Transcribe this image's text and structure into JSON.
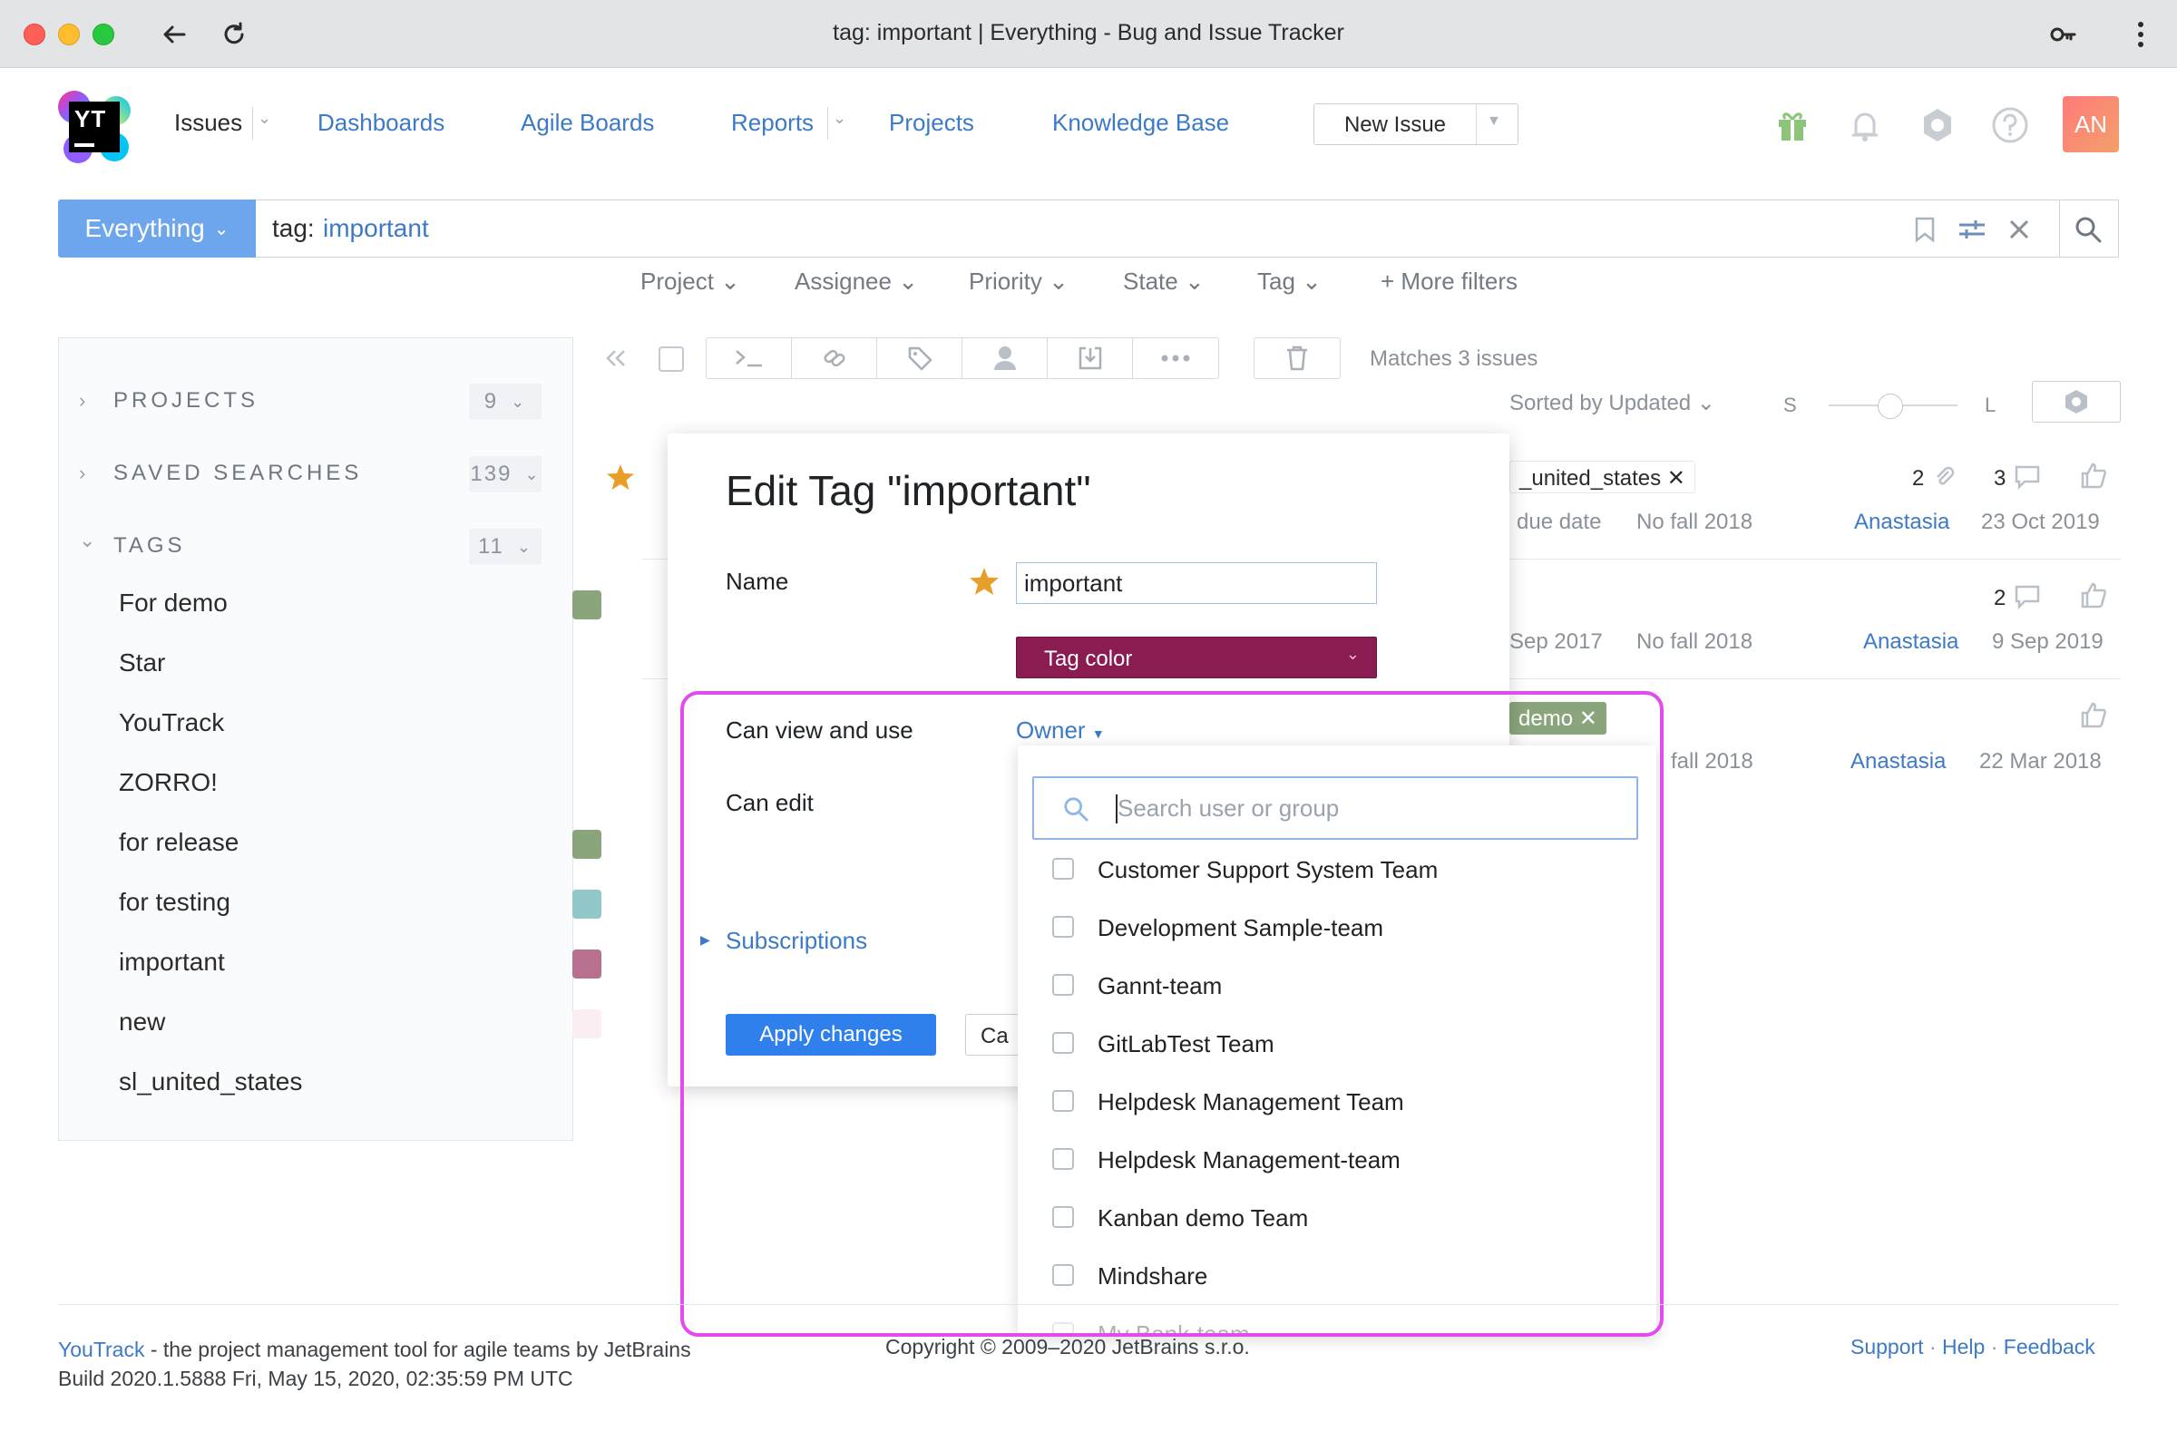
{
  "browser": {
    "window_title": "tag: important | Everything - Bug and Issue Tracker"
  },
  "header": {
    "logo_text": "YT",
    "nav": [
      {
        "label": "Issues"
      },
      {
        "label": "Dashboards"
      },
      {
        "label": "Agile Boards"
      },
      {
        "label": "Reports"
      },
      {
        "label": "Projects"
      },
      {
        "label": "Knowledge Base"
      }
    ],
    "new_issue_label": "New Issue",
    "avatar_initials": "AN"
  },
  "search": {
    "context_label": "Everything",
    "query_key": "tag:",
    "query_value": "important",
    "filters": [
      "Project",
      "Assignee",
      "Priority",
      "State",
      "Tag",
      "More filters"
    ]
  },
  "sidebar": {
    "sections": [
      {
        "title": "PROJECTS",
        "count": "9"
      },
      {
        "title": "SAVED SEARCHES",
        "count": "139"
      },
      {
        "title": "TAGS",
        "count": "11"
      }
    ],
    "tags": [
      {
        "label": "For demo",
        "color": "#8aa57c"
      },
      {
        "label": "Star",
        "color": ""
      },
      {
        "label": "YouTrack",
        "color": ""
      },
      {
        "label": "ZORRO!",
        "color": ""
      },
      {
        "label": "for release",
        "color": "#8aa57c"
      },
      {
        "label": "for testing",
        "color": "#92c7c9"
      },
      {
        "label": "important",
        "color": "#b8708f"
      },
      {
        "label": "new",
        "color": "#fbeef3"
      },
      {
        "label": "sl_united_states",
        "color": ""
      }
    ]
  },
  "list": {
    "matches": "Matches 3 issues",
    "sorted_by": "Sorted by Updated",
    "size_small": "S",
    "size_large": "L",
    "rows": [
      {
        "tag": "_united_states",
        "attachments": "2",
        "comments": "3",
        "field1": "due date",
        "field2": "No fall 2018",
        "assignee": "Anastasia",
        "date": "23 Oct 2019"
      },
      {
        "tag": "",
        "attachments": "",
        "comments": "2",
        "field1": "Sep 2017",
        "field2": "No fall 2018",
        "assignee": "Anastasia",
        "date": "9 Sep 2019"
      },
      {
        "tag": "demo",
        "attachments": "",
        "comments": "",
        "field1": "",
        "field2": "fall 2018",
        "assignee": "Anastasia",
        "date": "22 Mar 2018"
      }
    ]
  },
  "dialog": {
    "title": "Edit Tag \"important\"",
    "name_label": "Name",
    "name_value": "important",
    "tag_color_label": "Tag color",
    "tag_color": "#8a1c52",
    "can_view_label": "Can view and use",
    "can_view_value": "Owner",
    "can_edit_label": "Can edit",
    "subscriptions_label": "Subscriptions",
    "apply_label": "Apply changes",
    "cancel_label": "Ca"
  },
  "dropdown": {
    "search_placeholder": "Search user or group",
    "items": [
      "Customer Support System Team",
      "Development Sample-team",
      "Gannt-team",
      "GitLabTest Team",
      "Helpdesk Management Team",
      "Helpdesk Management-team",
      "Kanban demo Team",
      "Mindshare",
      "My Bank-team"
    ]
  },
  "footer": {
    "product": "YouTrack",
    "tagline": " - the project management tool for agile teams by JetBrains",
    "build": "Build 2020.1.5888 Fri, May 15, 2020, 02:35:59 PM UTC",
    "copyright": "Copyright © 2009–2020 JetBrains s.r.o.",
    "links": [
      "Support",
      "Help",
      "Feedback"
    ]
  },
  "colors": {
    "accent": "#3d7ac6",
    "primary_button": "#2f80ed",
    "highlight_frame": "#e44bee",
    "star": "#e89f2a"
  }
}
